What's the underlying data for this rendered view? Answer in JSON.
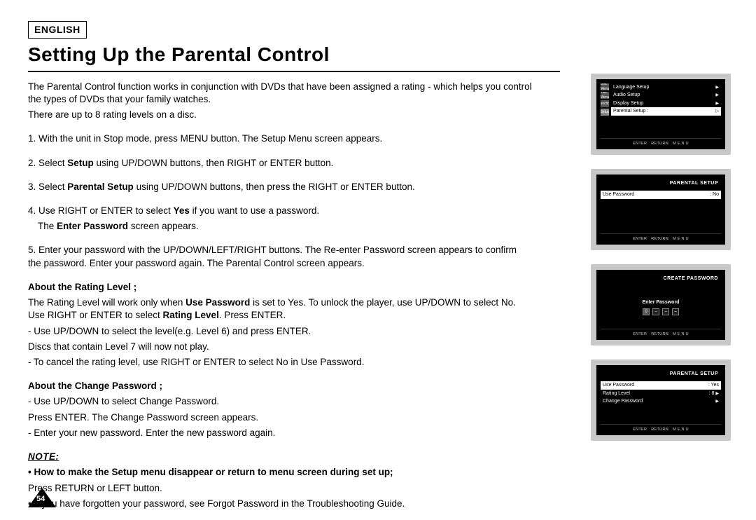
{
  "language_label": "ENGLISH",
  "heading": "Setting Up the Parental Control",
  "intro1": "The Parental Control function works in conjunction with DVDs that have been assigned a rating - which helps you control the types of DVDs that your family watches.",
  "intro2": "There are up to 8 rating levels on a disc.",
  "step1": "1. With the unit in Stop mode, press MENU button. The Setup Menu screen appears.",
  "step2a": "2. Select ",
  "step2b": "Setup",
  "step2c": " using UP/DOWN buttons, then RIGHT or ENTER button.",
  "step3a": "3. Select ",
  "step3b": "Parental Setup",
  "step3c": " using UP/DOWN buttons, then press the RIGHT or ENTER button.",
  "step4a": "4. Use RIGHT or ENTER to select ",
  "step4b": "Yes",
  "step4c": " if you want to use a password.",
  "step4d": "The ",
  "step4e": "Enter Password",
  "step4f": " screen appears.",
  "step5": "5. Enter your password with the UP/DOWN/LEFT/RIGHT buttons. The Re-enter Password screen appears to confirm the password. Enter your password again. The Parental Control screen appears.",
  "about_rating_title": "About the Rating Level ;",
  "about_rating_1a": "The Rating Level will work only when ",
  "about_rating_1b": "Use Password",
  "about_rating_1c": " is set to Yes. To unlock the player, use UP/DOWN to select No. Use RIGHT or ENTER to select ",
  "about_rating_1d": "Rating Level",
  "about_rating_1e": ". Press ENTER.",
  "about_rating_2": "- Use UP/DOWN to select the level(e.g. Level 6) and press ENTER.",
  "about_rating_3": "  Discs that contain Level 7 will now not play.",
  "about_rating_4": "- To cancel the rating level, use RIGHT or ENTER to select No in Use Password.",
  "about_pw_title": "About the Change Password ;",
  "about_pw_1": "- Use UP/DOWN to select Change Password.",
  "about_pw_2": "  Press ENTER. The Change Password screen appears.",
  "about_pw_3": "- Enter your new password. Enter the new password again.",
  "note_label": "NOTE:",
  "note_1": "• How to make the Setup menu disappear or return to menu screen during set up;",
  "note_2": "  Press RETURN or LEFT button.",
  "note_3": "• If you have forgotten your password, see Forgot Password in the Troubleshooting Guide.",
  "page_number": "54",
  "screen1": {
    "side": [
      "Disc Menu",
      "Title Menu",
      "Function",
      "Setup"
    ],
    "items": [
      "Language Setup",
      "Audio Setup",
      "Display Setup"
    ],
    "selected": "Parental Setup :",
    "footer": [
      "ENTER",
      "RETURN",
      "M E N U"
    ]
  },
  "screen2": {
    "title": "PARENTAL SETUP",
    "row_label": "Use Password",
    "row_value": ": No",
    "footer": [
      "ENTER",
      "RETURN",
      "M E N U"
    ]
  },
  "screen3": {
    "title": "CREATE PASSWORD",
    "prompt": "Enter Password",
    "digit": "0",
    "footer": [
      "ENTER",
      "RETURN",
      "M E N U"
    ]
  },
  "screen4": {
    "title": "PARENTAL SETUP",
    "r1_label": "Use Password",
    "r1_value": ": Yes",
    "r2_label": "Rating Level",
    "r2_value": ": 8",
    "r3_label": "Change Password",
    "footer": [
      "ENTER",
      "RETURN",
      "M E N U"
    ]
  }
}
